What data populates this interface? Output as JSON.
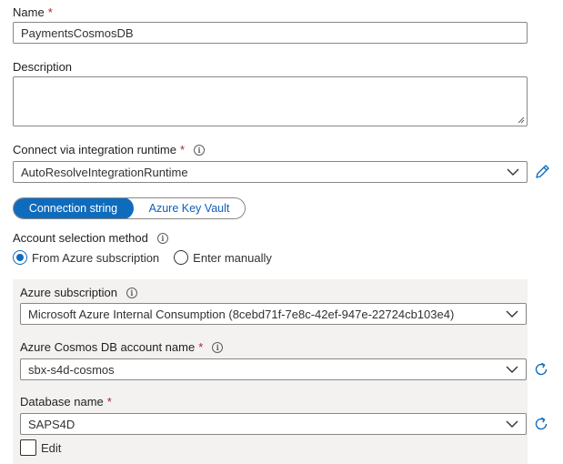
{
  "name_field": {
    "label": "Name",
    "required_mark": "*",
    "value": "PaymentsCosmosDB"
  },
  "description_field": {
    "label": "Description",
    "value": ""
  },
  "integration_runtime": {
    "label": "Connect via integration runtime",
    "required_mark": "*",
    "info_glyph": "i",
    "selected": "AutoResolveIntegrationRuntime"
  },
  "connection_type": {
    "options": [
      "Connection string",
      "Azure Key Vault"
    ],
    "selected": "Connection string"
  },
  "account_selection": {
    "label": "Account selection method",
    "info_glyph": "i",
    "options": [
      "From Azure subscription",
      "Enter manually"
    ],
    "selected": "From Azure subscription"
  },
  "azure_subscription": {
    "label": "Azure subscription",
    "info_glyph": "i",
    "selected": "Microsoft Azure Internal Consumption (8cebd71f-7e8c-42ef-947e-22724cb103e4)"
  },
  "cosmos_account": {
    "label": "Azure Cosmos DB account name",
    "required_mark": "*",
    "info_glyph": "i",
    "selected": "sbx-s4d-cosmos"
  },
  "database_name": {
    "label": "Database name",
    "required_mark": "*",
    "selected": "SAPS4D"
  },
  "edit_checkbox": {
    "label": "Edit",
    "checked": false
  },
  "colors": {
    "accent": "#0f6cbd",
    "required": "#a4262c",
    "panel_bg": "#f3f2f1",
    "border": "#8a8886"
  },
  "icons": {
    "dropdown": "chevron-down-icon",
    "edit": "pencil-icon",
    "refresh": "refresh-icon",
    "info": "info-icon"
  }
}
